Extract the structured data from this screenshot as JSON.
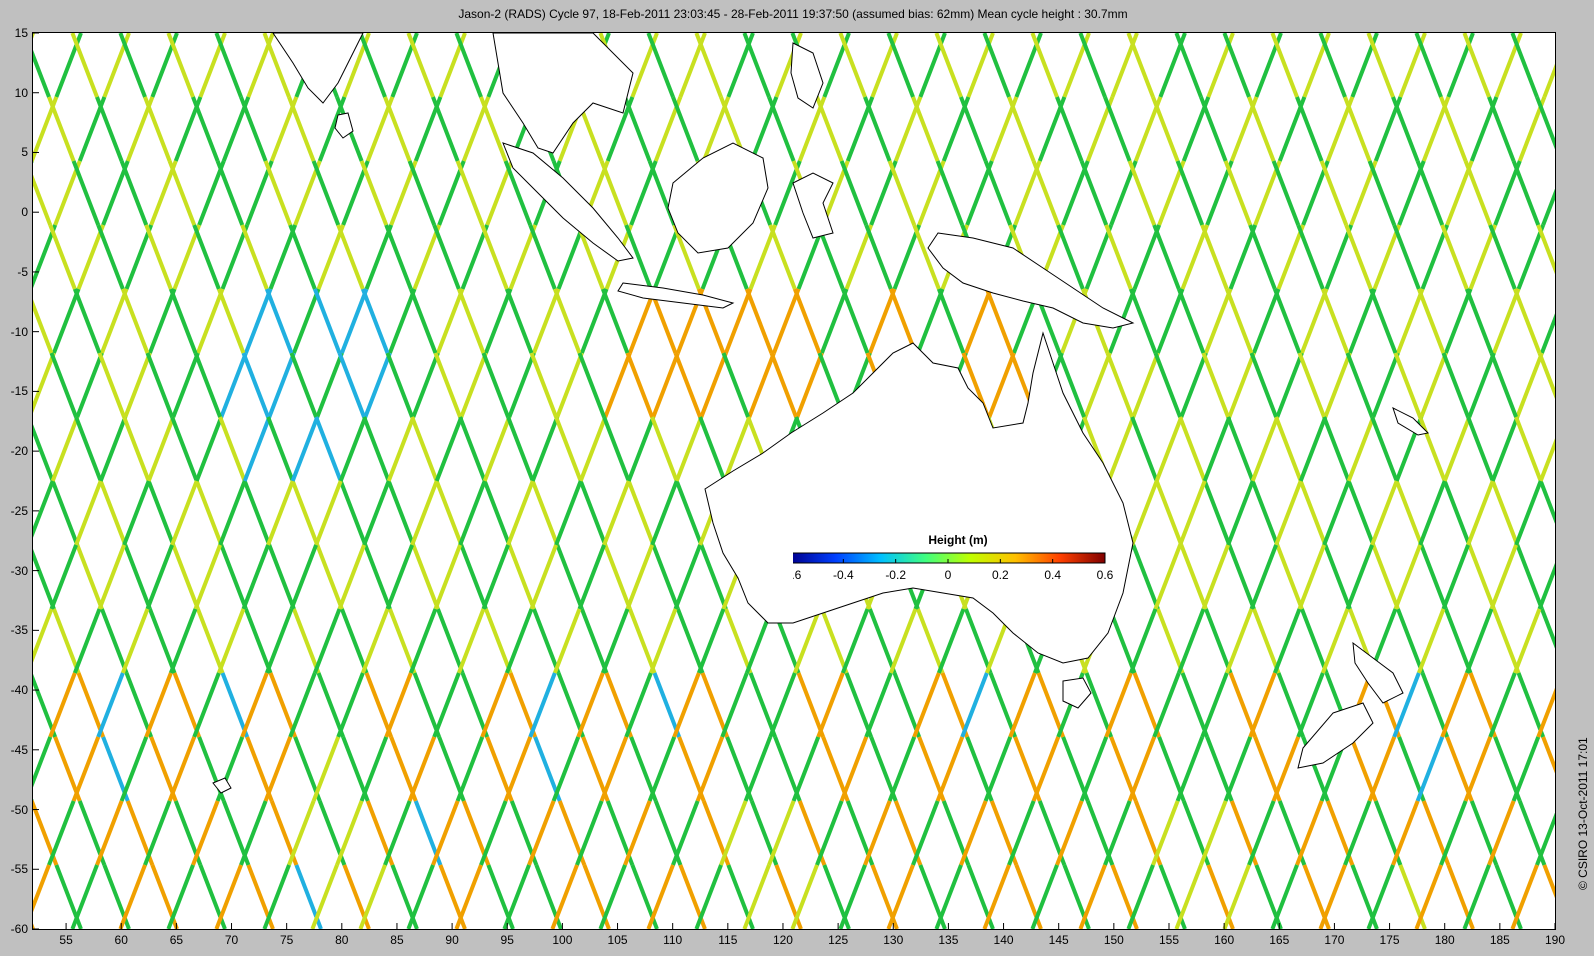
{
  "title": "Jason-2 (RADS) Cycle 97, 18-Feb-2011 23:03:45 - 28-Feb-2011 19:37:50 (assumed bias: 62mm)  Mean cycle height : 30.7mm",
  "credit": "© CSIRO 13-Oct-2011 17:01",
  "map": {
    "lon_range": [
      52,
      190
    ],
    "lat_range": [
      -60,
      15
    ],
    "x_ticks": [
      "55",
      "60",
      "65",
      "70",
      "75",
      "80",
      "85",
      "90",
      "95",
      "100",
      "105",
      "110",
      "115",
      "120",
      "125",
      "130",
      "135",
      "140",
      "145",
      "150",
      "155",
      "160",
      "165",
      "170",
      "175",
      "180",
      "185",
      "190"
    ],
    "y_ticks": [
      "15",
      "10",
      "5",
      "0",
      "-5",
      "-10",
      "-15",
      "-20",
      "-25",
      "-30",
      "-35",
      "-40",
      "-45",
      "-50",
      "-55",
      "-60"
    ]
  },
  "colorbar": {
    "title": "Height (m)",
    "range": [
      -0.6,
      0.6
    ],
    "tick_labels": [
      "-0.6",
      "-0.4",
      "-0.2",
      "0",
      "0.2",
      "0.4",
      "0.6"
    ],
    "colors": [
      "#00008f",
      "#0040ff",
      "#00c0ff",
      "#40ff80",
      "#c0ff00",
      "#ffc000",
      "#ff4000",
      "#800000"
    ]
  },
  "land_color": "#ffffff",
  "track_colors": {
    "low": "#20c040",
    "mid": "#c8e020",
    "high": "#f0a000",
    "very_high": "#c02000",
    "negative": "#20b0e0"
  }
}
